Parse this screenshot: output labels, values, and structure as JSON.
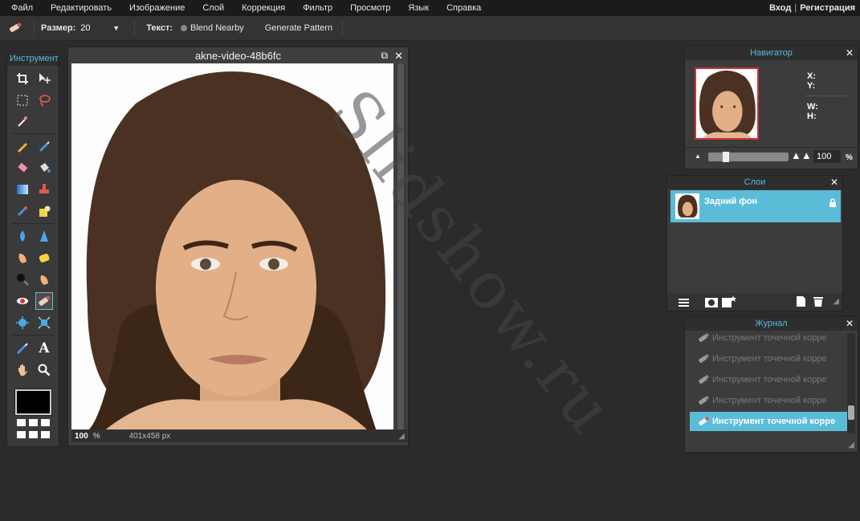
{
  "menu": {
    "items": [
      "Файл",
      "Редактировать",
      "Изображение",
      "Слой",
      "Коррекция",
      "Фильтр",
      "Просмотр",
      "Язык",
      "Справка"
    ],
    "login": "Вход",
    "separator": "|",
    "register": "Регистрация"
  },
  "options": {
    "size_label": "Размер:",
    "size_value": "20",
    "text_label": "Текст:",
    "option1": "Blend Nearby",
    "option2": "Generate Pattern"
  },
  "toolbox": {
    "title": "Инструмент"
  },
  "document": {
    "title": "akne-video-48b6fc",
    "zoom": "100",
    "zoom_unit": "%",
    "dimensions": "401x458 px"
  },
  "navigator": {
    "title": "Навигатор",
    "x_label": "X:",
    "y_label": "Y:",
    "w_label": "W:",
    "h_label": "H:",
    "zoom_value": "100",
    "zoom_unit": "%",
    "zoom_slider_fraction": 0.2
  },
  "layers": {
    "title": "Слои",
    "items": [
      {
        "name": "Задний фон",
        "selected": true,
        "locked": true
      }
    ]
  },
  "history": {
    "title": "Журнал",
    "items": [
      {
        "label": "Инструмент точечной корре",
        "selected": false
      },
      {
        "label": "Инструмент точечной корре",
        "selected": false
      },
      {
        "label": "Инструмент точечной корре",
        "selected": false
      },
      {
        "label": "Инструмент точечной корре",
        "selected": false
      },
      {
        "label": "Инструмент точечной корре",
        "selected": true
      }
    ]
  },
  "watermark": "Slidshow.ru",
  "colors": {
    "accent": "#5bbcd8",
    "panel_title": "#59b9e0",
    "foreground": "#000000"
  }
}
